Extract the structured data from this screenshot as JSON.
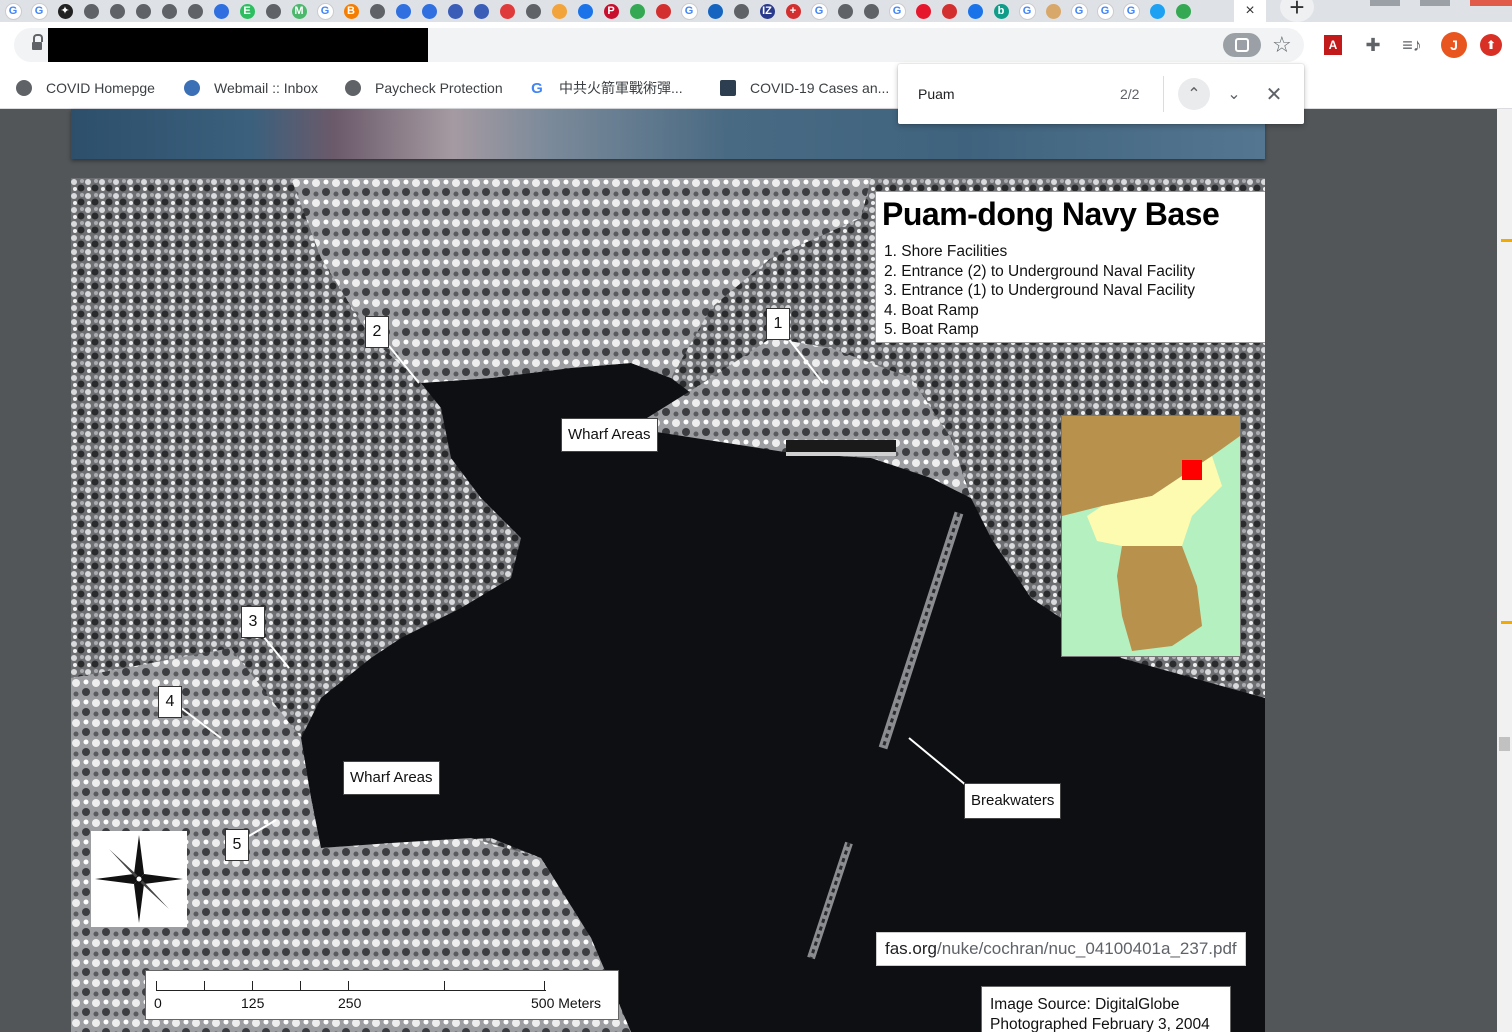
{
  "tab_strip": {
    "favicons": [
      "google",
      "google",
      "star",
      "globe",
      "globe",
      "globe",
      "globe",
      "globe",
      "baidu",
      "evernote",
      "globe",
      "mp",
      "google",
      "blogger",
      "globe",
      "baidu",
      "baidu",
      "planet",
      "planet",
      "pin",
      "globe",
      "orange",
      "blue",
      "p",
      "map",
      "red",
      "google",
      "moon",
      "globe",
      "iz",
      "cross",
      "google",
      "globe",
      "globe",
      "google",
      "weibo",
      "red",
      "blue",
      "b",
      "google",
      "box",
      "google",
      "google",
      "google",
      "twitter",
      "map"
    ],
    "active_tab_close": "×",
    "new_tab_label": "+"
  },
  "toolbar": {
    "find_icon": "find-in-page-icon",
    "bookmark_star": "☆",
    "avatar_initial": "J",
    "update_glyph": "⬆"
  },
  "bookmarks": [
    {
      "label": "COVID Homepge",
      "icon": "globe"
    },
    {
      "label": "Webmail :: Inbox",
      "icon": "webmail"
    },
    {
      "label": "Paycheck Protection",
      "icon": "globe"
    },
    {
      "label": "中共火箭軍戰術彈...",
      "icon": "google"
    },
    {
      "label": "COVID-19 Cases an...",
      "icon": "chart"
    }
  ],
  "find_bar": {
    "query": "Puam",
    "count": "2/2",
    "prev": "⌃",
    "next": "⌄",
    "close": "✕"
  },
  "map": {
    "title": "Puam-dong Navy Base",
    "legend_items": [
      "1. Shore Facilities",
      "2. Entrance (2) to Underground Naval Facility",
      "3. Entrance (1) to Underground Naval Facility",
      "4. Boat Ramp",
      "5. Boat Ramp"
    ],
    "labels": {
      "wharf_upper": "Wharf Areas",
      "wharf_lower": "Wharf Areas",
      "breakwaters": "Breakwaters"
    },
    "markers": [
      "1",
      "2",
      "3",
      "4",
      "5"
    ],
    "scale": {
      "ticks": [
        "0",
        "125",
        "250",
        "500 Meters"
      ]
    },
    "source_lines": [
      "Image Source: DigitalGlobe",
      "Photographed February 3, 2004"
    ],
    "inset_colors": {
      "north": "#fdfbb0",
      "south": "#b8914d",
      "land_top": "#b8914d",
      "sea": "#b5f0c0",
      "marker": "#ff0000"
    }
  },
  "url_tooltip": {
    "domain": "fas.org",
    "path": "/nuke/cochran/nuc_04100401a_237.pdf"
  }
}
